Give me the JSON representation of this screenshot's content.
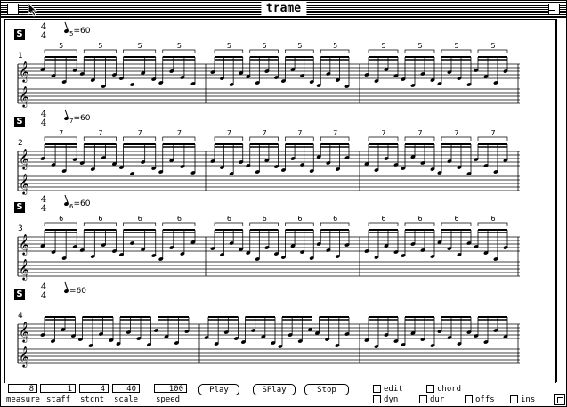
{
  "window": {
    "title": "trame"
  },
  "systems": [
    {
      "number": "1",
      "meter_top": "4",
      "meter_bottom": "4",
      "tempo": "=60",
      "tuplet_sub": "5",
      "tuplet": "5",
      "badge": "S"
    },
    {
      "number": "2",
      "meter_top": "4",
      "meter_bottom": "4",
      "tempo": "=60",
      "tuplet_sub": "7",
      "tuplet": "7",
      "badge": "S"
    },
    {
      "number": "3",
      "meter_top": "4",
      "meter_bottom": "4",
      "tempo": "=60",
      "tuplet_sub": "6",
      "tuplet": "6",
      "badge": "S"
    },
    {
      "number": "4",
      "meter_top": "4",
      "meter_bottom": "4",
      "tempo": "=60",
      "tuplet_sub": "",
      "tuplet": "",
      "badge": "S"
    }
  ],
  "toolbar": {
    "measure": {
      "value": "8",
      "label": "measure"
    },
    "staff": {
      "value": "1",
      "label": "staff"
    },
    "stcnt": {
      "value": "4",
      "label": "stcnt"
    },
    "scale": {
      "value": "40",
      "label": "scale"
    },
    "speed": {
      "value": "100",
      "label": "speed"
    },
    "play_label": "Play",
    "splay_label": "SPlay",
    "stop_label": "Stop",
    "checkboxes": {
      "edit": "edit",
      "chord": "chord",
      "dyn1": "dyn",
      "dur": "dur",
      "offs": "offs",
      "ins": "ins"
    }
  }
}
